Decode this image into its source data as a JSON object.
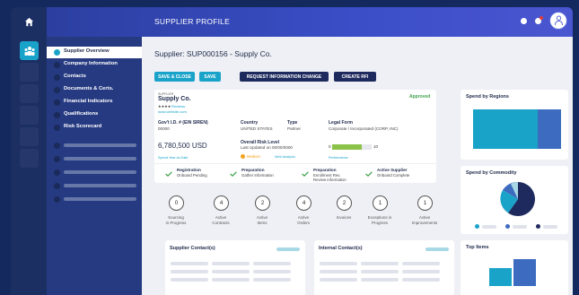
{
  "app": {
    "title": "SUPPLIER PROFILE"
  },
  "nav": {
    "items": [
      {
        "label": "Supplier Overview"
      },
      {
        "label": "Company Information"
      },
      {
        "label": "Contacts"
      },
      {
        "label": "Documents & Certs."
      },
      {
        "label": "Financial Indicators"
      },
      {
        "label": "Qualifications"
      },
      {
        "label": "Risk Scorecard"
      }
    ]
  },
  "page": {
    "heading": "Supplier: SUP000156 - Supply Co.",
    "buttons": {
      "save_close": "SAVE & CLOSE",
      "save": "SAVE",
      "request_change": "REQUEST INFORMATION CHANGE",
      "create_rfi": "CREATE RFI"
    }
  },
  "supplier": {
    "small_label": "SUPPLIER",
    "name": "Supply Co.",
    "stars": "★★★★",
    "reviews": "Reviews",
    "website": "www.website.com",
    "status": "Approved",
    "gov_id_label": "Gov't I.D. # (EIN SIREN)",
    "gov_id_value": "00000",
    "country_label": "Country",
    "country_value": "UNITED STATES",
    "type_label": "Type",
    "type_value": "Partner",
    "legal_label": "Legal Form",
    "legal_value": "Corporate / Incorporated (CORP, INC)",
    "spend": "6,780,500 USD",
    "spend_label": "Spend Year-to-Date",
    "risk_label": "Overall Risk Level",
    "risk_updated": "Last Updated on 00/00/0000",
    "risk_level": "Medium",
    "web_analysis": "Web Analysis",
    "perf_min": "0",
    "perf_max": "10",
    "perf_value": 7.5,
    "perf_label": "Performance",
    "steps": [
      {
        "title": "Registration",
        "sub": "Onboard Pending"
      },
      {
        "title": "Preparation",
        "sub": "Gather Information"
      },
      {
        "title": "Preparation",
        "sub": "Enrollment Rev.",
        "sub2": "Review Information"
      },
      {
        "title": "Active Supplier",
        "sub": "Onboard Complete"
      }
    ],
    "stats": [
      {
        "value": "0",
        "label": "Sourcing",
        "label2": "in Progress"
      },
      {
        "value": "4",
        "label": "Active",
        "label2": "Contracts"
      },
      {
        "value": "2",
        "label": "Active",
        "label2": "Items"
      },
      {
        "value": "4",
        "label": "Active",
        "label2": "Orders"
      },
      {
        "value": "2",
        "label": "Invoices",
        "label2": ""
      },
      {
        "value": "1",
        "label": "Exceptions in",
        "label2": "Progress"
      },
      {
        "value": "1",
        "label": "Active",
        "label2": "Improvements"
      }
    ]
  },
  "contacts": {
    "supplier_title": "Supplier Contact(s)",
    "internal_title": "Internal Contact(s)"
  },
  "widgets": {
    "regions_title": "Spend by Regions",
    "commodity_title": "Spend by Commodity",
    "top_items_title": "Top Items"
  },
  "colors": {
    "teal": "#1aa3c9",
    "blue": "#3d6bbf",
    "navy": "#1e2a5e",
    "green": "#8bc34a",
    "approved": "#3fa34d",
    "medium": "#f2a31b"
  }
}
